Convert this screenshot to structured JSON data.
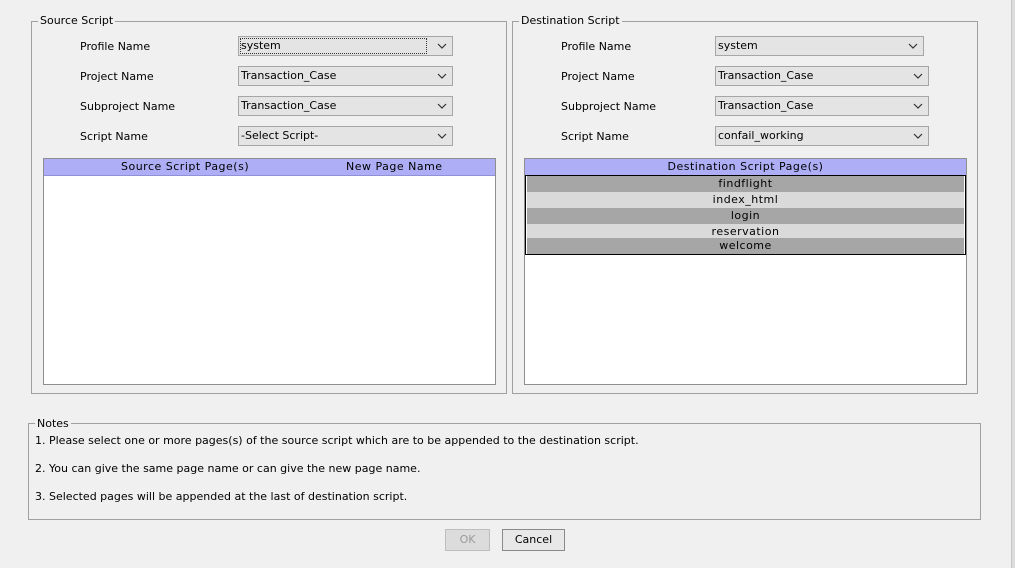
{
  "source": {
    "legend": "Source Script",
    "profile": {
      "label": "Profile Name",
      "value": "system"
    },
    "project": {
      "label": "Project Name",
      "value": "Transaction_Case"
    },
    "subproject": {
      "label": "Subproject Name",
      "value": "Transaction_Case"
    },
    "script": {
      "label": "Script Name",
      "value": "-Select Script-"
    },
    "table": {
      "col1": "Source Script Page(s)",
      "col2": "New Page Name"
    }
  },
  "destination": {
    "legend": "Destination Script",
    "profile": {
      "label": "Profile Name",
      "value": "system"
    },
    "project": {
      "label": "Project Name",
      "value": "Transaction_Case"
    },
    "subproject": {
      "label": "Subproject Name",
      "value": "Transaction_Case"
    },
    "script": {
      "label": "Script Name",
      "value": "confail_working"
    },
    "table": {
      "header": "Destination Script Page(s)",
      "rows": [
        "findflight",
        "index_html",
        "login",
        "reservation",
        "welcome"
      ]
    }
  },
  "notes": {
    "legend": "Notes",
    "lines": [
      "1. Please select one or more pages(s) of the source script which are to be appended to the destination script.",
      "2. You can give the same page name or can give the new page name.",
      "3. Selected pages will be appended at the last of destination script."
    ]
  },
  "buttons": {
    "ok": "OK",
    "cancel": "Cancel"
  }
}
